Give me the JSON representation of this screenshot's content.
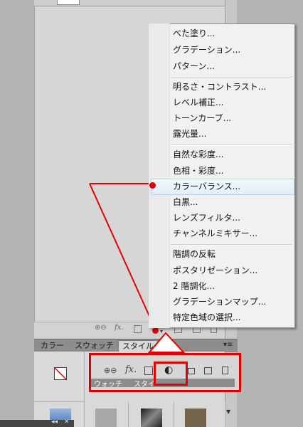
{
  "menu": {
    "groups": [
      [
        "べた塗り...",
        "グラデーション...",
        "パターン..."
      ],
      [
        "明るさ・コントラスト...",
        "レベル補正...",
        "トーンカーブ...",
        "露光量..."
      ],
      [
        "自然な彩度...",
        "色相・彩度...",
        "カラーバランス...",
        "白黒...",
        "レンズフィルタ...",
        "チャンネルミキサー..."
      ],
      [
        "階調の反転",
        "ポスタリゼーション...",
        "2 階調化...",
        "グラデーションマップ...",
        "特定色域の選択..."
      ]
    ],
    "highlighted": "カラーバランス..."
  },
  "panel": {
    "tabs": [
      "カラー",
      "スウォッチ",
      "スタイル"
    ],
    "menu_button": "▾≡"
  },
  "toolbar": {
    "link_icon": "⊕⊖",
    "fx_label": "fx."
  },
  "zoom": {
    "tabs_visible": [
      "ウォッチ",
      "スタイ"
    ]
  },
  "mini_bar": {
    "collapse": "◂◂",
    "close": "✕"
  },
  "colors": {
    "annotation_red": "#e00000",
    "menu_highlight": "#e3edf9"
  }
}
